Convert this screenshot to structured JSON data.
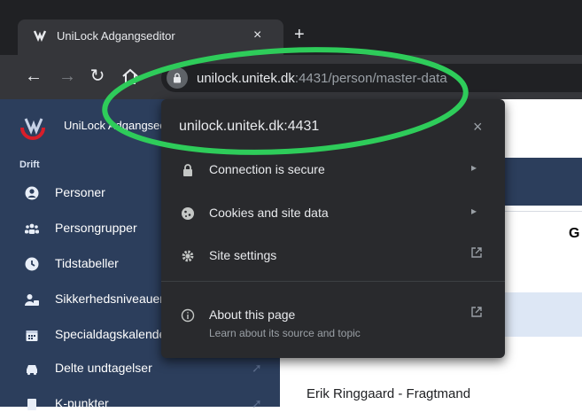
{
  "browser": {
    "tab_title": "UniLock Adgangseditor",
    "tab_close": "×",
    "new_tab": "+",
    "url_host": "unilock.unitek.dk",
    "url_rest": ":4431/person/master-data"
  },
  "site_info_popup": {
    "title": "unilock.unitek.dk:4431",
    "close": "×",
    "rows": [
      {
        "label": "Connection is secure",
        "icon": "lock-icon",
        "end_icon": "chevron-right-icon"
      },
      {
        "label": "Cookies and site data",
        "icon": "cookie-icon",
        "end_icon": "chevron-right-icon"
      },
      {
        "label": "Site settings",
        "icon": "gear-icon",
        "end_icon": "external-link-icon"
      },
      {
        "label": "About this page",
        "sublabel": "Learn about its source and topic",
        "icon": "info-icon",
        "end_icon": "external-link-icon"
      }
    ]
  },
  "sidebar": {
    "brand": "UniLock Adgangseditor",
    "section": "Drift",
    "items": [
      {
        "label": "Personer",
        "icon": "user-circle-icon"
      },
      {
        "label": "Persongrupper",
        "icon": "users-icon"
      },
      {
        "label": "Tidstabeller",
        "icon": "clock-icon"
      },
      {
        "label": "Sikkerhedsniveauer",
        "icon": "user-lock-icon"
      },
      {
        "label": "Specialdagskalender",
        "icon": "calendar-icon"
      },
      {
        "label": "Delte undtagelser",
        "icon": "car-icon"
      },
      {
        "label": "K-punkter",
        "icon": "doc-icon"
      }
    ]
  },
  "content": {
    "header_letter": "G",
    "row_text": "Erik Ringgaard - Fragtmand"
  },
  "colors": {
    "sidebar_bg": "#2c3e5c",
    "popup_bg": "#292a2d",
    "annotation_ring": "#2ecc5a",
    "brand_red": "#d81e2a"
  }
}
